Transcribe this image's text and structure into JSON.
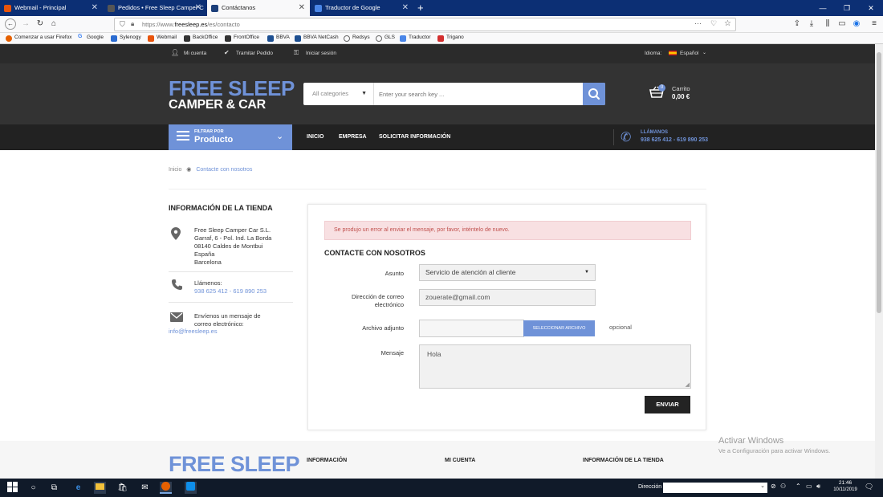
{
  "browser": {
    "tabs": [
      {
        "title": "Webmail - Principal",
        "active": false,
        "icon_color": "#e8540c"
      },
      {
        "title": "Pedidos • Free Sleep Camper C",
        "active": false,
        "icon_color": "#2a2a2a"
      },
      {
        "title": "Contáctanos",
        "active": true,
        "icon_color": "#1c3f7a"
      },
      {
        "title": "Traductor de Google",
        "active": false,
        "icon_color": "#4a86e8"
      }
    ],
    "new_tab_symbol": "+",
    "url_prefix": "https://www.",
    "url_host": "freesleep.es",
    "url_path": "/es/contacto",
    "bookmarks": [
      {
        "label": "Comenzar a usar Firefox",
        "color": "#e66000"
      },
      {
        "label": "Google",
        "color": "#4285f4"
      },
      {
        "label": "Sylenogy",
        "color": "#2a6bd1"
      },
      {
        "label": "Webmail",
        "color": "#e8540c"
      },
      {
        "label": "BackOffice",
        "color": "#333333"
      },
      {
        "label": "FrontOffice",
        "color": "#333333"
      },
      {
        "label": "BBVA",
        "color": "#1d4f91"
      },
      {
        "label": "BBVA NetCash",
        "color": "#1d4f91"
      },
      {
        "label": "Redsys",
        "color": "#666666"
      },
      {
        "label": "GLS",
        "color": "#f6b600"
      },
      {
        "label": "Traductor",
        "color": "#4a86e8"
      },
      {
        "label": "Trigano",
        "color": "#d32f2f"
      }
    ]
  },
  "site": {
    "topbar": {
      "my_account": "Mi cuenta",
      "process_order": "Tramitar Pedido",
      "login": "Iniciar sesión",
      "language_label": "Idioma:",
      "language_value": "Español"
    },
    "logo_line1": "FREE SLEEP",
    "logo_line2": "CAMPER & CAR",
    "search": {
      "category": "All categories",
      "placeholder": "Enter your search key ..."
    },
    "cart": {
      "label": "Carrito",
      "amount": "0,00 €",
      "count": "0"
    },
    "filter": {
      "small": "FILTRAR POR",
      "big": "Producto"
    },
    "menu": [
      "INICIO",
      "EMPRESA",
      "SOLICITAR INFORMACIÓN"
    ],
    "call": {
      "label": "LLÁMANOS",
      "phones": "938 625 412 - 619 890 253"
    },
    "breadcrumb": {
      "home": "Inicio",
      "current": "Contacte con nosotros"
    },
    "store": {
      "title": "INFORMACIÓN DE LA TIENDA",
      "address": [
        "Free Sleep Camper Car S.L.",
        "Garraf, 6 - Pol. Ind. La Borda",
        "08140 Caldes de Montbui",
        "España",
        "Barcelona"
      ],
      "call_label": "Llámenos:",
      "call_phones": "938 625 412 - 619 890 253",
      "email_label_1": "Envíenos un mensaje de",
      "email_label_2": "correo electrónico:",
      "email": "info@freesleep.es"
    },
    "form": {
      "error": "Se produjo un error al enviar el mensaje, por favor, inténtelo de nuevo.",
      "title": "CONTACTE CON NOSOTROS",
      "subject_label": "Asunto",
      "subject_value": "Servicio de atención al cliente",
      "email_label_1": "Dirección de correo",
      "email_label_2": "electrónico",
      "email_value": "zouerate@gmail.com",
      "attachment_label": "Archivo adjunto",
      "attachment_button": "SELECCIONAR ARCHIVO",
      "optional": "opcional",
      "message_label": "Mensaje",
      "message_value": "Hola",
      "send": "ENVIAR"
    },
    "footer": {
      "logo": "FREE SLEEP",
      "col1": "INFORMACIÓN",
      "col2": "MI CUENTA",
      "col3": "INFORMACIÓN DE LA TIENDA"
    }
  },
  "windows": {
    "watermark_title": "Activar Windows",
    "watermark_sub": "Ve a Configuración para activar Windows.",
    "address_label": "Dirección",
    "time": "21:46",
    "date": "10/11/2019"
  }
}
